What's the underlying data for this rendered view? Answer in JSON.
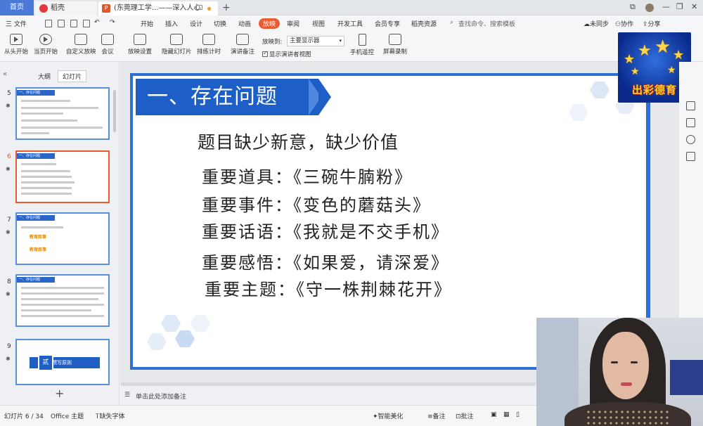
{
  "tabs": {
    "home": "首页",
    "docer": "稻壳",
    "document": "(东莞理工学...——深入人心",
    "new_tab": "+"
  },
  "menubar": {
    "file": "三 文件",
    "items": [
      "开始",
      "插入",
      "设计",
      "切换",
      "动画",
      "放映",
      "审阅",
      "视图",
      "开发工具",
      "会员专享",
      "稻壳资源"
    ],
    "active_item": "放映",
    "search_placeholder": "查找命令、搜索模板",
    "sync": "未同步",
    "collab": "协作",
    "share": "分享"
  },
  "ribbon": {
    "from_start": "从头开始",
    "from_current": "当页开始",
    "custom_show": "自定义放映",
    "meeting": "会议",
    "setup_show": "放映设置",
    "hide_slide": "隐藏幻灯片",
    "rehearse": "排练计时",
    "speaker_notes": "演讲备注",
    "show_to_label": "放映到:",
    "show_to_value": "主要显示器",
    "presenter_view": "显示演讲者视图",
    "phone_remote": "手机遥控",
    "screen_record": "屏幕录制"
  },
  "left_panel": {
    "tab_outline": "大纲",
    "tab_slides": "幻灯片",
    "thumbnails": [
      {
        "num": "5",
        "header": "一、存在问题"
      },
      {
        "num": "6",
        "header": "一、存在问题"
      },
      {
        "num": "7",
        "header": "一、存在问题",
        "label_a": "教育叙事",
        "label_b": "教育叙事"
      },
      {
        "num": "8",
        "header": "一、存在问题"
      },
      {
        "num": "9",
        "badge": "贰",
        "banner": "撰写原则"
      }
    ]
  },
  "slide": {
    "title": "一、存在问题",
    "subtitle": "题目缺少新意，缺少价值",
    "lines": [
      "重要道具：《三碗牛腩粉》",
      "重要事件：《变色的蘑菇头》",
      "重要话语：《我就是不交手机》",
      "重要感悟：《如果爱，请深爱》",
      "重要主题：《守一株荆棘花开》"
    ]
  },
  "notes_placeholder": "单击此处添加备注",
  "statusbar": {
    "slide_counter": "幻灯片 6 / 34",
    "theme": "Office 主题",
    "missing_font": "缺失字体",
    "smart_beautify": "智能美化",
    "notes": "备注",
    "comments": "批注"
  },
  "logo_text": "出彩德育"
}
